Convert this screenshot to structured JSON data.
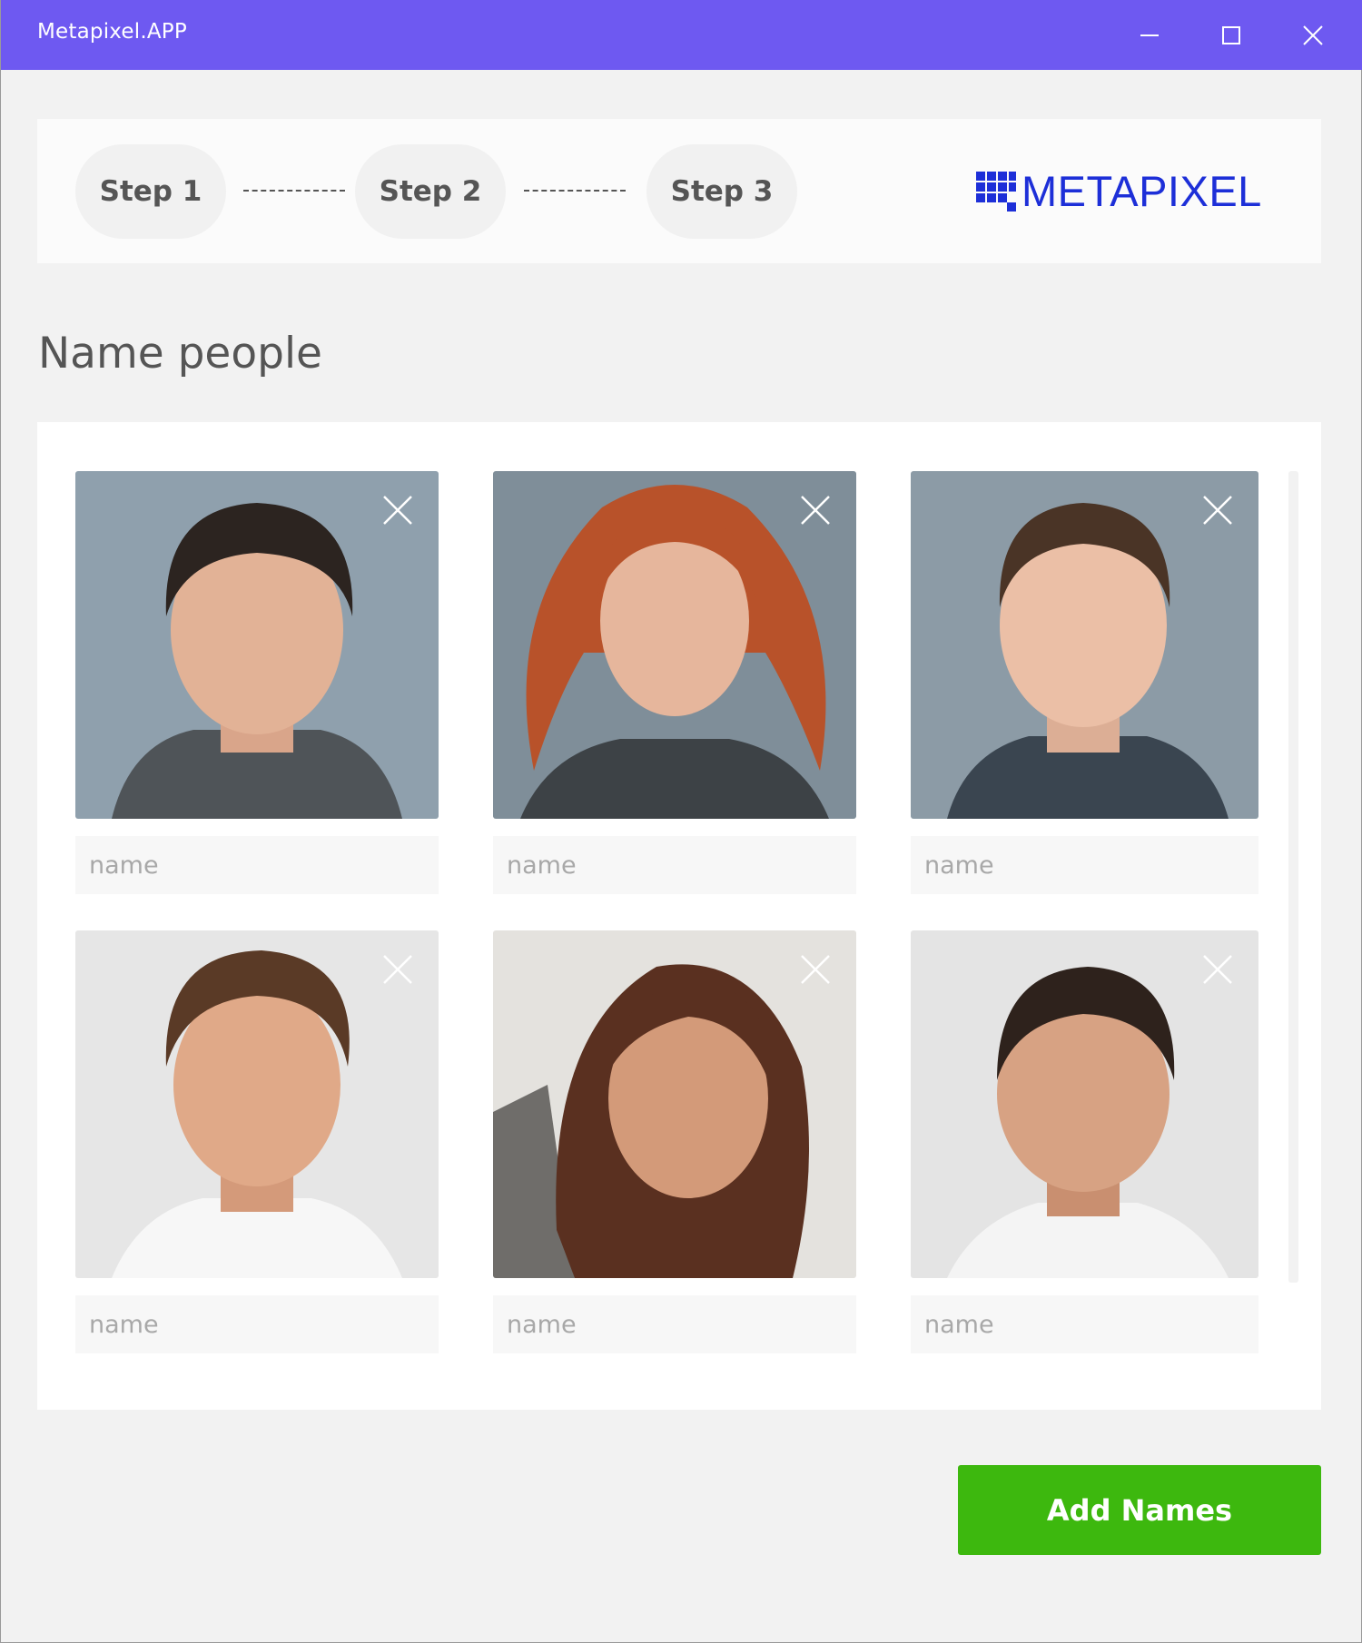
{
  "window": {
    "title": "Metapixel.APP",
    "controls": {
      "minimize_icon": "minimize-icon",
      "maximize_icon": "maximize-icon",
      "close_icon": "close-icon"
    },
    "titlebar_color": "#6e59f1"
  },
  "stepper": {
    "steps": [
      {
        "label": "Step 1"
      },
      {
        "label": "Step 2"
      },
      {
        "label": "Step 3"
      }
    ],
    "logo_text": "METAPIXEL",
    "logo_color": "#1d2fd8"
  },
  "main": {
    "title": "Name people",
    "people": [
      {
        "photo": "person-photo-1",
        "name_value": "",
        "name_placeholder": "name",
        "remove_icon": "close-icon"
      },
      {
        "photo": "person-photo-2",
        "name_value": "",
        "name_placeholder": "name",
        "remove_icon": "close-icon"
      },
      {
        "photo": "person-photo-3",
        "name_value": "",
        "name_placeholder": "name",
        "remove_icon": "close-icon"
      },
      {
        "photo": "person-photo-4",
        "name_value": "",
        "name_placeholder": "name",
        "remove_icon": "close-icon"
      },
      {
        "photo": "person-photo-5",
        "name_value": "",
        "name_placeholder": "name",
        "remove_icon": "close-icon"
      },
      {
        "photo": "person-photo-6",
        "name_value": "",
        "name_placeholder": "name",
        "remove_icon": "close-icon"
      }
    ]
  },
  "actions": {
    "add_label": "Add Names",
    "add_color": "#3db80e"
  }
}
